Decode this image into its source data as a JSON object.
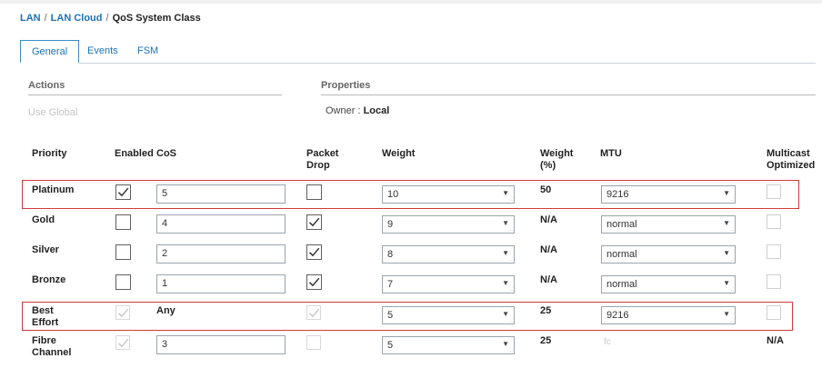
{
  "breadcrumb": {
    "items": [
      "LAN",
      "LAN Cloud"
    ],
    "current": "QoS System Class",
    "separator": "/"
  },
  "tabs": [
    {
      "label": "General",
      "active": true
    },
    {
      "label": "Events",
      "active": false
    },
    {
      "label": "FSM",
      "active": false
    }
  ],
  "actions": {
    "title": "Actions",
    "use_global": "Use Global"
  },
  "properties": {
    "title": "Properties",
    "owner_label": "Owner :",
    "owner_value": "Local"
  },
  "table": {
    "headers": {
      "priority": "Priority",
      "enabled": "Enabled",
      "cos": "CoS",
      "packet_drop": [
        "Packet",
        "Drop"
      ],
      "weight": "Weight",
      "weight_pct": [
        "Weight",
        "(%)"
      ],
      "mtu": "MTU",
      "multicast": [
        "Multicast",
        "Optimized"
      ]
    },
    "rows": [
      {
        "priority": [
          "Platinum"
        ],
        "enabled": true,
        "enabled_disabled": false,
        "cos": "5",
        "cos_editable": true,
        "packet_drop": false,
        "packet_drop_disabled": false,
        "weight": "10",
        "weight_pct": "50",
        "mtu": "9216",
        "mtu_select": true,
        "multicast": "",
        "highlighted": true
      },
      {
        "priority": [
          "Gold"
        ],
        "enabled": false,
        "enabled_disabled": false,
        "cos": "4",
        "cos_editable": true,
        "packet_drop": true,
        "packet_drop_disabled": false,
        "weight": "9",
        "weight_pct": "N/A",
        "mtu": "normal",
        "mtu_select": true,
        "multicast": "",
        "highlighted": false
      },
      {
        "priority": [
          "Silver"
        ],
        "enabled": false,
        "enabled_disabled": false,
        "cos": "2",
        "cos_editable": true,
        "packet_drop": true,
        "packet_drop_disabled": false,
        "weight": "8",
        "weight_pct": "N/A",
        "mtu": "normal",
        "mtu_select": true,
        "multicast": "",
        "highlighted": false
      },
      {
        "priority": [
          "Bronze"
        ],
        "enabled": false,
        "enabled_disabled": false,
        "cos": "1",
        "cos_editable": true,
        "packet_drop": true,
        "packet_drop_disabled": false,
        "weight": "7",
        "weight_pct": "N/A",
        "mtu": "normal",
        "mtu_select": true,
        "multicast": "",
        "highlighted": false
      },
      {
        "priority": [
          "Best",
          "Effort"
        ],
        "enabled": true,
        "enabled_disabled": true,
        "cos": "Any",
        "cos_editable": false,
        "packet_drop": true,
        "packet_drop_disabled": true,
        "weight": "5",
        "weight_pct": "25",
        "mtu": "9216",
        "mtu_select": true,
        "multicast": "",
        "highlighted": true
      },
      {
        "priority": [
          "Fibre",
          "Channel"
        ],
        "enabled": true,
        "enabled_disabled": true,
        "cos": "3",
        "cos_editable": true,
        "packet_drop": false,
        "packet_drop_disabled": true,
        "weight": "5",
        "weight_pct": "25",
        "mtu": "fc",
        "mtu_select": false,
        "multicast": "N/A",
        "highlighted": false
      }
    ]
  },
  "icons": {
    "dropdown": "chevron-down-icon",
    "check": "check-icon"
  },
  "colors": {
    "link": "#1b72b8",
    "highlight": "#d23a3a",
    "tab_border": "#3a8fc9"
  }
}
